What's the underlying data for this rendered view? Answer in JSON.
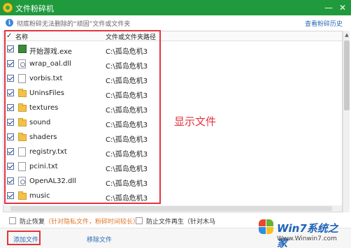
{
  "window": {
    "title": "文件粉碎机",
    "minimize_symbol": "—",
    "close_symbol": "✕"
  },
  "info": {
    "text": "彻底粉碎无法删除的“顽固”文件或文件夹",
    "history_link": "查看粉碎历史"
  },
  "list": {
    "header": {
      "name": "名称",
      "path": "文件或文件夹路径"
    },
    "rows": [
      {
        "name": "开始游戏.exe",
        "path": "C:\\孤岛危机3",
        "icon": "exe"
      },
      {
        "name": "wrap_oal.dll",
        "path": "C:\\孤岛危机3",
        "icon": "dll"
      },
      {
        "name": "vorbis.txt",
        "path": "C:\\孤岛危机3",
        "icon": "doc"
      },
      {
        "name": "UninsFiles",
        "path": "C:\\孤岛危机3",
        "icon": "folder"
      },
      {
        "name": "textures",
        "path": "C:\\孤岛危机3",
        "icon": "folder"
      },
      {
        "name": "sound",
        "path": "C:\\孤岛危机3",
        "icon": "folder"
      },
      {
        "name": "shaders",
        "path": "C:\\孤岛危机3",
        "icon": "folder"
      },
      {
        "name": "registry.txt",
        "path": "C:\\孤岛危机3",
        "icon": "doc"
      },
      {
        "name": "pcini.txt",
        "path": "C:\\孤岛危机3",
        "icon": "doc"
      },
      {
        "name": "OpenAL32.dll",
        "path": "C:\\孤岛危机3",
        "icon": "dll"
      },
      {
        "name": "music",
        "path": "C:\\孤岛危机3",
        "icon": "folder"
      }
    ]
  },
  "annotation": "显示文件",
  "options": {
    "recover_label": "防止恢复",
    "recover_note": "（针对隐私文件，粉碎时间较长）",
    "regen_label": "防止文件再生",
    "regen_note": "（针对木马"
  },
  "bottom": {
    "add_label": "添加文件",
    "remove_label": "移除文件"
  },
  "watermark": {
    "brand": "Win7系统之家",
    "url": "Www.Winwin7.com"
  },
  "colors": {
    "titlebar": "#1f9a3c",
    "highlight": "#e3343d",
    "link": "#2a6ab6"
  }
}
